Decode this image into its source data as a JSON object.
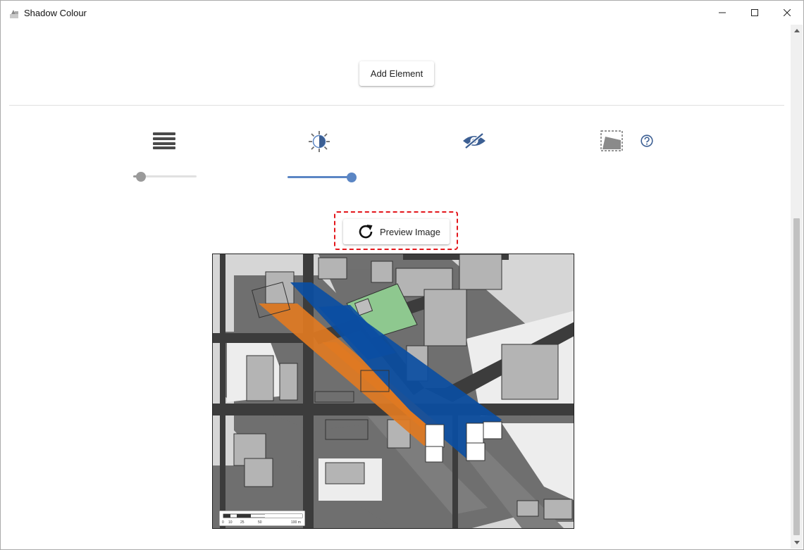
{
  "window": {
    "title": "Shadow Colour",
    "controls": [
      "minimize-icon",
      "maximize-icon",
      "close-icon"
    ]
  },
  "toolbar": {
    "add_element_label": "Add Element",
    "icons": [
      "layers-icon",
      "brightness-icon",
      "eye-off-icon",
      "region-select-icon",
      "help-icon"
    ]
  },
  "sliders": {
    "layer_opacity": 0.12,
    "brightness": 1.0
  },
  "preview": {
    "button_label": "Preview Image",
    "icon": "refresh-icon"
  },
  "map": {
    "scale": {
      "ticks": [
        "0",
        "10",
        "25",
        "50",
        "100 m"
      ]
    },
    "colors": {
      "shadow_orange": "#e07a22",
      "shadow_blue": "#0b4ea2",
      "park_green": "#8ec88f",
      "building_grey": "#b4b4b4",
      "shadow_grey": "#6f6f6f"
    }
  },
  "colors": {
    "accent": "#5b86c4",
    "highlight_border": "#e3161b"
  }
}
